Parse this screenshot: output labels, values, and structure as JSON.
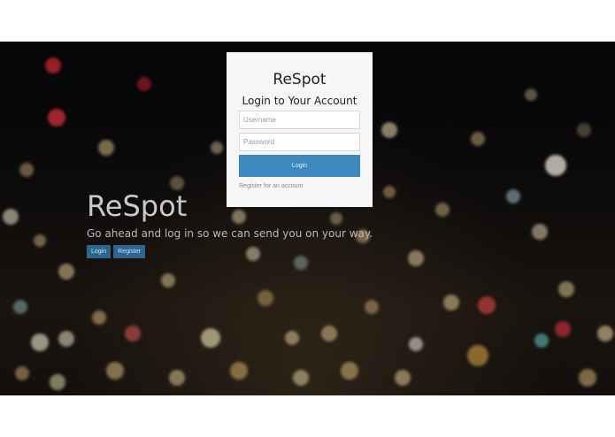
{
  "hero": {
    "title": "ReSpot",
    "subtitle": "Go ahead and log in so we can send you on your way.",
    "login_label": "Login",
    "register_label": "Register"
  },
  "card": {
    "brand": "ReSpot",
    "heading": "Login to Your Account",
    "username_placeholder": "Username",
    "password_placeholder": "Password",
    "submit_label": "Login",
    "register_link": "Register for an account"
  },
  "colors": {
    "accent": "#3d88bf",
    "hero_button": "#2c6690",
    "card_background": "#f6f6f6"
  }
}
